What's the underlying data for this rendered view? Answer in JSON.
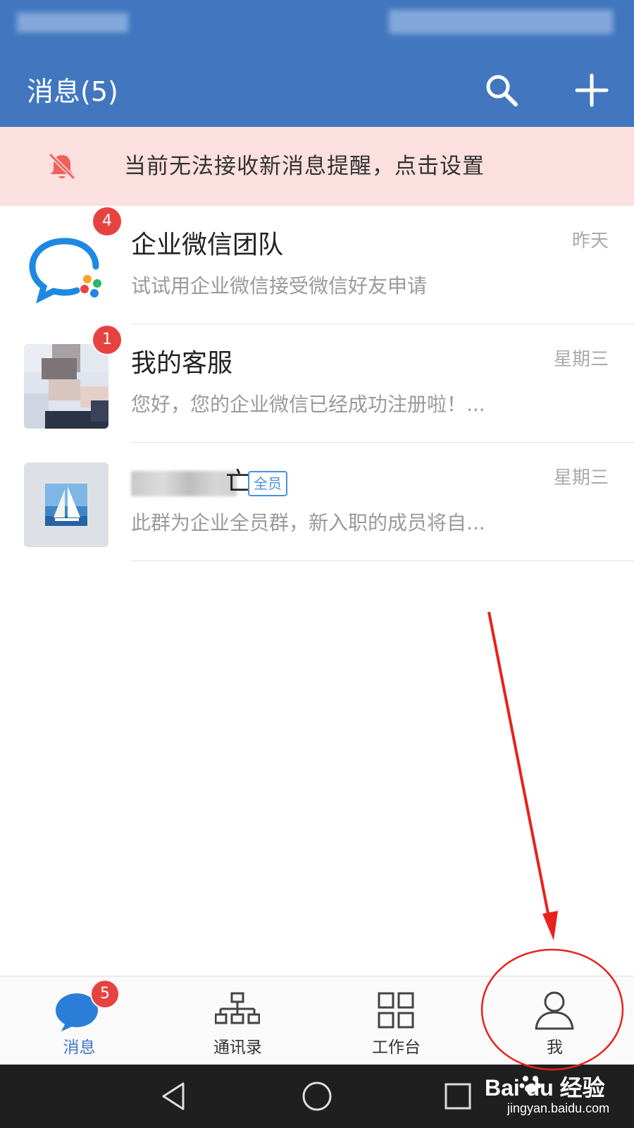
{
  "header": {
    "title": "消息(5)",
    "search_icon": "search-icon",
    "add_icon": "plus-icon"
  },
  "banner": {
    "icon": "bell-muted-icon",
    "text": "当前无法接收新消息提醒，点击设置"
  },
  "messages": [
    {
      "name": "企业微信团队",
      "preview": "试试用企业微信接受微信好友申请",
      "time": "昨天",
      "badge": "4"
    },
    {
      "name": "我的客服",
      "preview": "您好，您的企业微信已经成功注册啦！...",
      "time": "星期三",
      "badge": "1"
    },
    {
      "name_visible_suffix": "亡",
      "tag": "全员",
      "preview": "此群为企业全员群，新入职的成员将自...",
      "time": "星期三"
    }
  ],
  "tabs": [
    {
      "label": "消息",
      "icon": "chat-bubble-icon",
      "badge": "5",
      "active": true
    },
    {
      "label": "通讯录",
      "icon": "org-chart-icon"
    },
    {
      "label": "工作台",
      "icon": "grid-icon"
    },
    {
      "label": "我",
      "icon": "person-icon"
    }
  ],
  "colors": {
    "primary": "#4277bf",
    "banner_bg": "#fbe0df",
    "badge": "#e64340",
    "active_tab": "#3f77c6",
    "annotation": "#e8221b"
  },
  "watermark": {
    "logo": "Bai du 经验",
    "url": "jingyan.baidu.com"
  }
}
